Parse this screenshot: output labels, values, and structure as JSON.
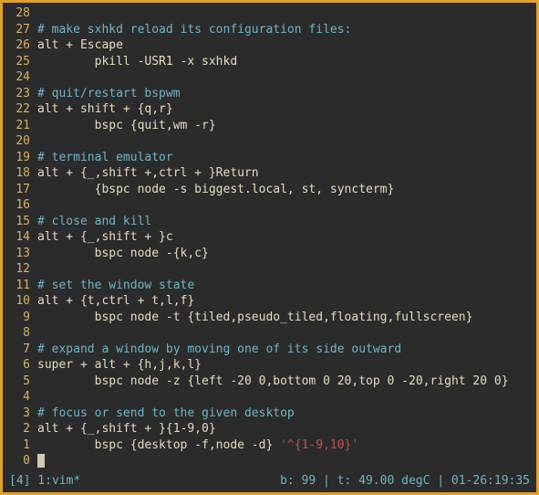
{
  "lines": [
    {
      "n": "28",
      "t": ""
    },
    {
      "n": "27",
      "t": "# make sxhkd reload its configuration files:"
    },
    {
      "n": "26",
      "t": "alt + Escape"
    },
    {
      "n": "25",
      "t": "        pkill -USR1 -x sxhkd"
    },
    {
      "n": "24",
      "t": ""
    },
    {
      "n": "23",
      "t": "# quit/restart bspwm"
    },
    {
      "n": "22",
      "t": "alt + shift + {q,r}"
    },
    {
      "n": "21",
      "t": "        bspc {quit,wm -r}"
    },
    {
      "n": "20",
      "t": ""
    },
    {
      "n": "19",
      "t": "# terminal emulator"
    },
    {
      "n": "18",
      "t": "alt + {_,shift +,ctrl + }Return"
    },
    {
      "n": "17",
      "t": "        {bspc node -s biggest.local, st, syncterm}"
    },
    {
      "n": "16",
      "t": ""
    },
    {
      "n": "15",
      "t": "# close and kill"
    },
    {
      "n": "14",
      "t": "alt + {_,shift + }c"
    },
    {
      "n": "13",
      "t": "        bspc node -{k,c}"
    },
    {
      "n": "12",
      "t": ""
    },
    {
      "n": "11",
      "t": "# set the window state"
    },
    {
      "n": "10",
      "t": "alt + {t,ctrl + t,l,f}"
    },
    {
      "n": "9",
      "t": "        bspc node -t {tiled,pseudo_tiled,floating,fullscreen}"
    },
    {
      "n": "8",
      "t": ""
    },
    {
      "n": "7",
      "t": "# expand a window by moving one of its side outward"
    },
    {
      "n": "6",
      "t": "super + alt + {h,j,k,l}"
    },
    {
      "n": "5",
      "t": "        bspc node -z {left -20 0,bottom 0 20,top 0 -20,right 20 0}"
    },
    {
      "n": "4",
      "t": ""
    },
    {
      "n": "3",
      "t": "# focus or send to the given desktop"
    },
    {
      "n": "2",
      "t": "alt + {_,shift + }{1-9,0}"
    },
    {
      "n": "1",
      "t": "        bspc {desktop -f,node -d} ",
      "r": "'^{1-9,10}'"
    },
    {
      "n": "0",
      "t": ""
    }
  ],
  "status": {
    "left": "[4] 1:vim*",
    "right": "b: 99 | t: 49.00 degC | 01-26:19:35"
  },
  "colors": {
    "border": "#e0a030",
    "bg": "#2b2b2b",
    "fg": "#d0c8b0",
    "gutter": "#d6b060",
    "comment": "#6fb3c9",
    "red": "#c05050"
  }
}
